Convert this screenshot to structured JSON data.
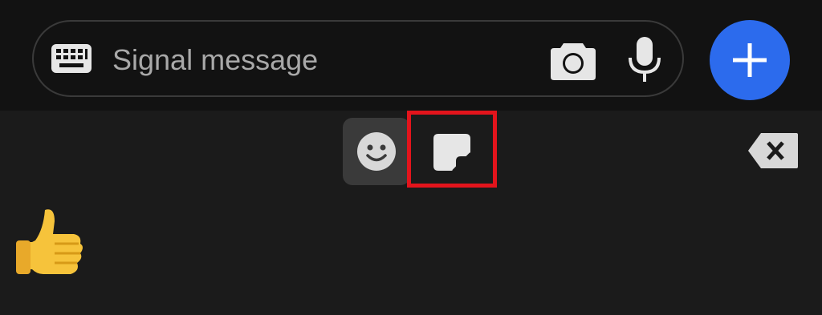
{
  "compose": {
    "placeholder": "Signal message",
    "value": "",
    "keyboard_icon": "keyboard-icon",
    "camera_icon": "camera-icon",
    "mic_icon": "microphone-icon",
    "attach_icon": "plus-icon"
  },
  "picker": {
    "tabs": [
      {
        "name": "emoji",
        "icon": "smiley-icon",
        "selected": true
      },
      {
        "name": "stickers",
        "icon": "sticker-icon",
        "selected": false,
        "highlighted": true
      }
    ],
    "backspace_icon": "backspace-icon",
    "emojis": [
      "👍"
    ]
  },
  "colors": {
    "background": "#1b1b1b",
    "top_bar": "#121212",
    "accent": "#2c6bed",
    "highlight": "#e3141c",
    "selected_tab": "#3a3a3a",
    "icon": "#e6e6e6"
  }
}
